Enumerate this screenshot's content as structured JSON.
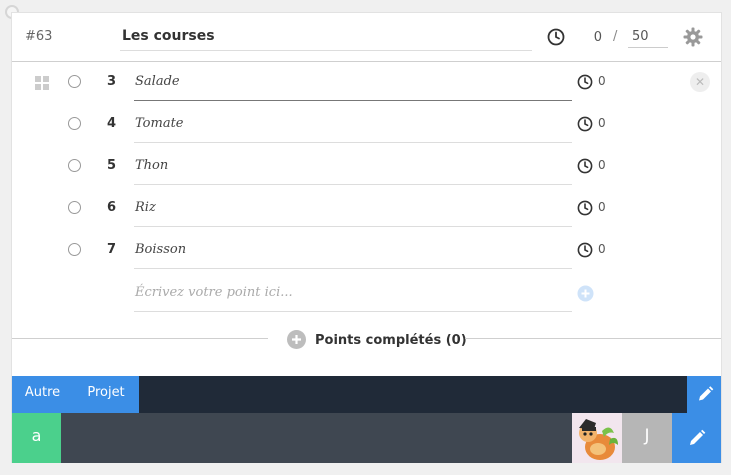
{
  "card": {
    "id": "#63",
    "title": "Les courses",
    "time_spent": "0",
    "time_separator": "/",
    "time_estimate": "50"
  },
  "items": [
    {
      "number": "3",
      "text": "Salade",
      "time": "0"
    },
    {
      "number": "4",
      "text": "Tomate",
      "time": "0"
    },
    {
      "number": "5",
      "text": "Thon",
      "time": "0"
    },
    {
      "number": "6",
      "text": "Riz",
      "time": "0"
    },
    {
      "number": "7",
      "text": "Boisson",
      "time": "0"
    }
  ],
  "new_item": {
    "placeholder": "Écrivez votre point ici..."
  },
  "completed": {
    "label": "Points complétés (0)"
  },
  "tags": [
    {
      "label": "Autre"
    },
    {
      "label": "Projet"
    }
  ],
  "users": [
    {
      "initial": "a",
      "color": "#4bd08c"
    },
    {
      "initial": "",
      "avatar": "cartoon-character-avatar"
    },
    {
      "initial": "J",
      "color": "#b6b6b6"
    }
  ],
  "colors": {
    "accent": "#3b8ee6",
    "tag_bar": "#202a38",
    "user_bar": "#3f4751"
  },
  "icons": [
    "clock-icon",
    "gear-icon",
    "drag-handle-icon",
    "remove-icon",
    "add-icon",
    "pencil-icon"
  ]
}
